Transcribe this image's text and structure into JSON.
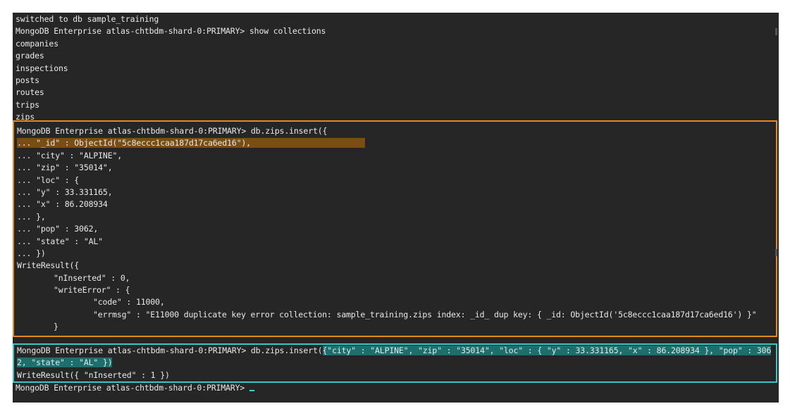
{
  "terminal": {
    "top_lines": [
      "switched to db sample_training",
      "MongoDB Enterprise atlas-chtbdm-shard-0:PRIMARY> show collections",
      "companies",
      "grades",
      "inspections",
      "posts",
      "routes",
      "trips",
      "zips"
    ],
    "insert1": {
      "prompt_line": "MongoDB Enterprise atlas-chtbdm-shard-0:PRIMARY> db.zips.insert({",
      "highlighted_line": "... \"_id\" : ObjectId(\"5c8eccc1caa187d17ca6ed16\"),",
      "lines": [
        "... \"city\" : \"ALPINE\",",
        "... \"zip\" : \"35014\",",
        "... \"loc\" : {",
        "... \"y\" : 33.331165,",
        "... \"x\" : 86.208934",
        "... },",
        "... \"pop\" : 3062,",
        "... \"state\" : \"AL\"",
        "... })"
      ],
      "result": {
        "open": "WriteResult({",
        "n_inserted": "\"nInserted\" : 0,",
        "write_error_open": "\"writeError\" : {",
        "code": "\"code\" : 11000,",
        "errmsg": "\"errmsg\" : \"E11000 duplicate key error collection: sample_training.zips index: _id_ dup key: { _id: ObjectId('5c8eccc1caa187d17ca6ed16') }\"",
        "write_error_close": "}",
        "close": "})"
      }
    },
    "insert2": {
      "prompt": "MongoDB Enterprise atlas-chtbdm-shard-0:PRIMARY> db.zips.insert(",
      "args_line1": "{\"city\" : \"ALPINE\", \"zip\" : \"35014\", \"loc\" : { \"y\" : 33.331165, \"x\" : 86.208934 }, \"pop\" : 306",
      "args_line2": "2, \"state\" : \"AL\" })",
      "result": "WriteResult({ \"nInserted\" : 1 })"
    },
    "final_prompt": "MongoDB Enterprise atlas-chtbdm-shard-0:PRIMARY> ",
    "colors": {
      "background": "#262626",
      "text": "#e9e9e9",
      "orange_border": "#e8871e",
      "orange_highlight": "#7a4d15",
      "teal_border": "#37c7c7",
      "teal_highlight": "#1f6e6e"
    }
  }
}
